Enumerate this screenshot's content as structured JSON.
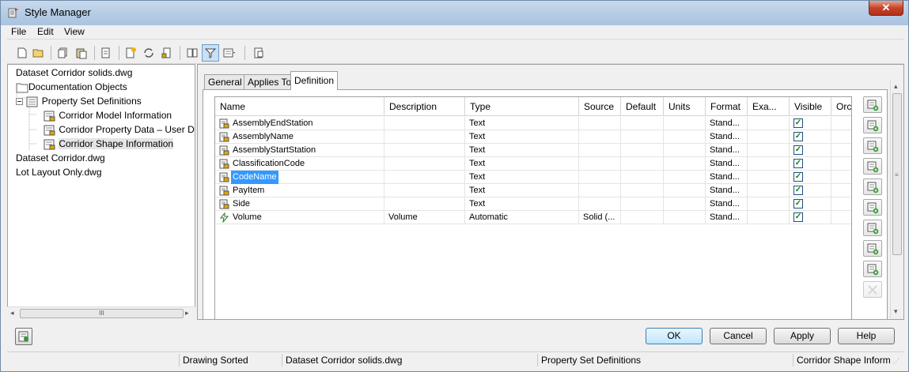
{
  "window": {
    "title": "Style Manager"
  },
  "menu": {
    "file": "File",
    "edit": "Edit",
    "view": "View"
  },
  "toolbar": {
    "icons": [
      "new-icon",
      "open-icon",
      "copy-icon",
      "paste-icon",
      "purge-icon",
      "new-style-icon",
      "refresh-icon",
      "edit-style-icon",
      "toggle-view-icon",
      "filter-icon",
      "view-options-icon",
      "help-icon"
    ]
  },
  "tree": {
    "nodes": [
      {
        "label": "Dataset Corridor solids.dwg"
      },
      {
        "label": "Documentation Objects"
      },
      {
        "label": "Property Set Definitions"
      },
      {
        "label": "Corridor Model Information"
      },
      {
        "label": "Corridor Property Data – User D"
      },
      {
        "label": "Corridor Shape Information"
      },
      {
        "label": "Dataset Corridor.dwg"
      },
      {
        "label": "Lot Layout Only.dwg"
      }
    ],
    "scroll_thumb": "III"
  },
  "tabs": [
    {
      "label": "General"
    },
    {
      "label": "Applies To"
    },
    {
      "label": "Definition"
    }
  ],
  "grid": {
    "columns": [
      "Name",
      "Description",
      "Type",
      "Source",
      "Default",
      "Units",
      "Format",
      "Exa...",
      "Visible",
      "Orc"
    ],
    "rows": [
      {
        "name": "AssemblyEndStation",
        "description": "",
        "type": "Text",
        "source": "",
        "default": "",
        "units": "",
        "format": "Stand...",
        "example": "",
        "visible": true,
        "icon": "property-icon"
      },
      {
        "name": "AssemblyName",
        "description": "",
        "type": "Text",
        "source": "",
        "default": "",
        "units": "",
        "format": "Stand...",
        "example": "",
        "visible": true,
        "icon": "property-icon"
      },
      {
        "name": "AssemblyStartStation",
        "description": "",
        "type": "Text",
        "source": "",
        "default": "",
        "units": "",
        "format": "Stand...",
        "example": "",
        "visible": true,
        "icon": "property-icon"
      },
      {
        "name": "ClassificationCode",
        "description": "",
        "type": "Text",
        "source": "",
        "default": "",
        "units": "",
        "format": "Stand...",
        "example": "",
        "visible": true,
        "icon": "property-icon"
      },
      {
        "name": "CodeName",
        "description": "",
        "type": "Text",
        "source": "",
        "default": "",
        "units": "",
        "format": "Stand...",
        "example": "",
        "visible": true,
        "icon": "property-icon",
        "selected": true
      },
      {
        "name": "PayItem",
        "description": "",
        "type": "Text",
        "source": "",
        "default": "",
        "units": "",
        "format": "Stand...",
        "example": "",
        "visible": true,
        "icon": "property-icon"
      },
      {
        "name": "Side",
        "description": "",
        "type": "Text",
        "source": "",
        "default": "",
        "units": "",
        "format": "Stand...",
        "example": "",
        "visible": true,
        "icon": "property-icon"
      },
      {
        "name": "Volume",
        "description": "Volume",
        "type": "Automatic",
        "source": "Solid (...",
        "default": "",
        "units": "",
        "format": "Stand...",
        "example": "",
        "visible": true,
        "icon": "automatic-property-icon"
      }
    ]
  },
  "side_buttons": [
    "add-manual-property-icon",
    "add-automatic-property-icon",
    "add-formula-property-icon",
    "add-location-property-icon",
    "add-classification-property-icon",
    "add-material-property-icon",
    "add-graphic-property-icon",
    "add-anchor-property-icon",
    "add-project-property-icon",
    "delete-property-icon"
  ],
  "buttons": {
    "ok": "OK",
    "cancel": "Cancel",
    "apply": "Apply",
    "help": "Help"
  },
  "status": {
    "sort": "Drawing Sorted",
    "drawing": "Dataset Corridor solids.dwg",
    "category": "Property Set Definitions",
    "style": "Corridor Shape Inform"
  },
  "colors": {
    "selection": "#3399ff",
    "title_bar": "#b4cbe4",
    "close_button": "#c7432a"
  }
}
